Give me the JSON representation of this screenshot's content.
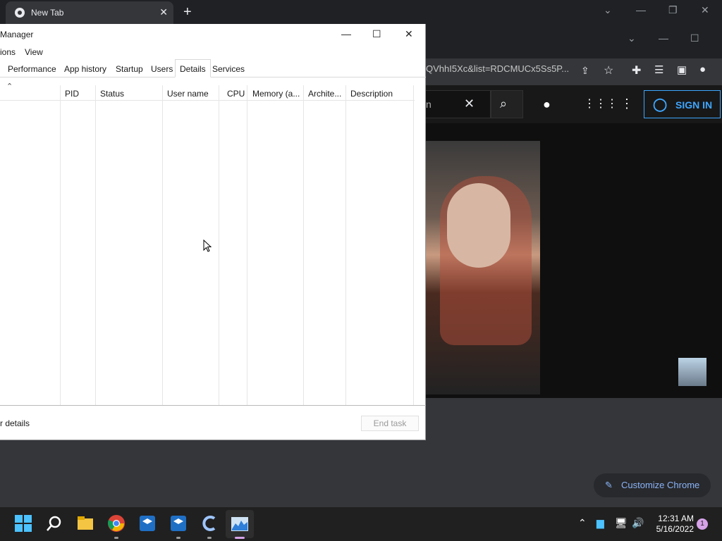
{
  "browser": {
    "tab_title": "New Tab",
    "url_fragment": "QVhhI5Xc&list=RDCMUCx5Ss5P...",
    "sign_in": "SIGN IN",
    "search_fragment": "n",
    "customize": "Customize Chrome"
  },
  "task_manager": {
    "title": "Manager",
    "menu": [
      "ions",
      "View"
    ],
    "tabs": [
      "Performance",
      "App history",
      "Startup",
      "Users",
      "Details",
      "Services"
    ],
    "active_tab": "Details",
    "columns": [
      "PID",
      "Status",
      "User name",
      "CPU",
      "Memory (a...",
      "Archite...",
      "Description"
    ],
    "fewer_details": "r details",
    "end_task": "End task"
  },
  "taskbar": {
    "time": "12:31 AM",
    "date": "5/16/2022",
    "notification_count": "1"
  },
  "colors": {
    "accent_blue": "#3ea6ff",
    "chrome_link": "#8ab4f8",
    "taskbar": "#202020"
  }
}
